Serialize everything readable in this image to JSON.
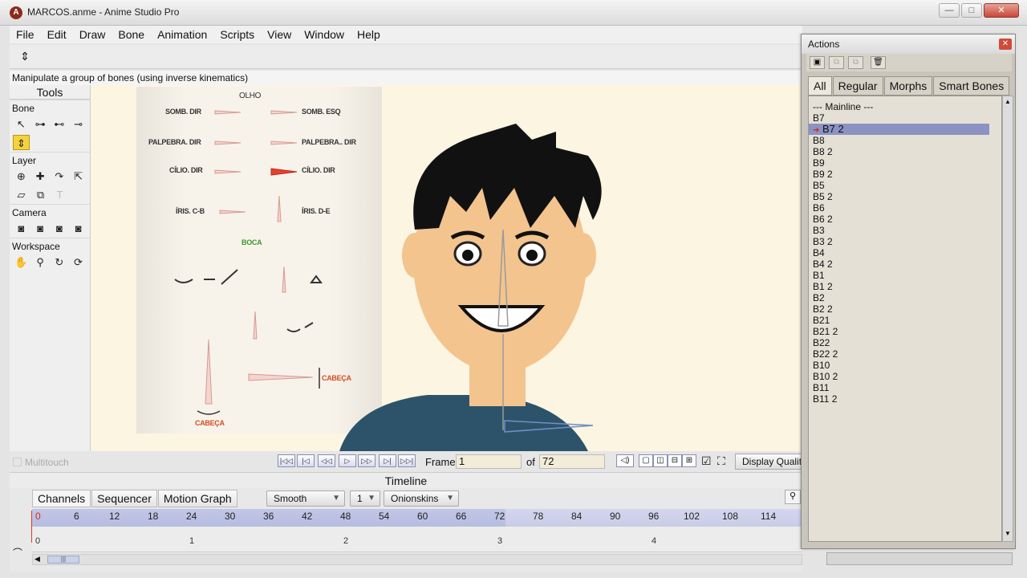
{
  "window": {
    "title": "MARCOS.anme - Anime Studio Pro",
    "app_icon_letter": "A"
  },
  "window_buttons": {
    "minimize": "—",
    "maximize": "□",
    "close": "✕"
  },
  "menu": [
    "File",
    "Edit",
    "Draw",
    "Bone",
    "Animation",
    "Scripts",
    "View",
    "Window",
    "Help"
  ],
  "status_text": "Manipulate a group of bones (using inverse kinematics)",
  "tools": {
    "title": "Tools",
    "groups": [
      {
        "label": "Bone"
      },
      {
        "label": "Layer"
      },
      {
        "label": "Camera"
      },
      {
        "label": "Workspace"
      }
    ]
  },
  "reference_sheet": {
    "title": "OLHO",
    "labels": {
      "somb_dir": "SOMB. DIR",
      "somb_esq": "SOMB. ESQ",
      "palpebra_dir": "PALPEBRA. DIR",
      "palpebra_dir2": "PALPEBRA.. DIR",
      "cilio_dir": "CÍLIO. DIR",
      "cilio_dir2": "CÍLIO. DIR",
      "iris_cb": "ÍRIS. C-B",
      "iris_de": "ÍRIS. D-E",
      "boca": "BOCA",
      "cabeca1": "CABEÇA",
      "cabeca2": "CABEÇA"
    }
  },
  "playback": {
    "multitouch": "Multitouch",
    "frame_label": "Frame",
    "frame_value": "1",
    "of_label": "of",
    "total_frames": "72",
    "display_quality": "Display Quality"
  },
  "timeline": {
    "title": "Timeline",
    "tabs": [
      "Channels",
      "Sequencer",
      "Motion Graph"
    ],
    "interp": "Smooth",
    "step": "1",
    "onionskins": "Onionskins",
    "ruler": [
      "0",
      "6",
      "12",
      "18",
      "24",
      "30",
      "36",
      "42",
      "48",
      "54",
      "60",
      "66",
      "72",
      "78",
      "84",
      "90",
      "96",
      "102",
      "108",
      "114"
    ],
    "track_ticks": [
      "0",
      "1",
      "2",
      "3",
      "4"
    ],
    "current_frame_fraction": 0.0
  },
  "actions": {
    "title": "Actions",
    "tabs": [
      "All",
      "Regular",
      "Morphs",
      "Smart Bones"
    ],
    "active_tab": "All",
    "selected": "B7 2",
    "items": [
      "--- Mainline ---",
      "B7",
      "B7 2",
      "B8",
      "B8 2",
      "B9",
      "B9 2",
      "B5",
      "B5 2",
      "B6",
      "B6 2",
      "B3",
      "B3 2",
      "B4",
      "B4 2",
      "B1",
      "B1 2",
      "B2",
      "B2 2",
      "B21",
      "B21 2",
      "B22",
      "B22 2",
      "B10",
      "B10 2",
      "B11",
      "B11 2"
    ]
  },
  "colors": {
    "accent_selection": "#8c92c2",
    "tool_selected": "#f3d23d",
    "canvas_bg": "#fbf5e2",
    "bone_red": "#d84c20"
  }
}
